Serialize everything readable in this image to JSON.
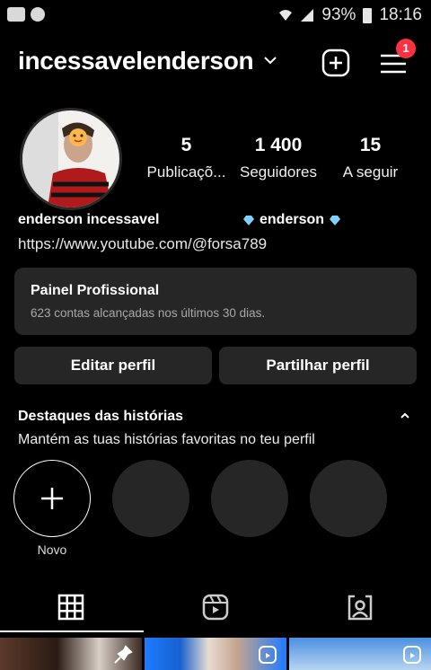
{
  "status_bar": {
    "battery": "93%",
    "time": "18:16"
  },
  "header": {
    "username": "incessavelenderson",
    "notification_count": "1"
  },
  "profile": {
    "stats": [
      {
        "value": "5",
        "label": "Publicaçõ..."
      },
      {
        "value": "1 400",
        "label": "Seguidores"
      },
      {
        "value": "15",
        "label": "A seguir"
      }
    ],
    "display_name": "enderson incessavel",
    "bio_name": "enderson",
    "link": "https://www.youtube.com/@forsa789"
  },
  "dashboard": {
    "title": "Painel Profissional",
    "subtitle": "623 contas alcançadas nos últimos 30 dias."
  },
  "buttons": {
    "edit": "Editar perfil",
    "share": "Partilhar perfil"
  },
  "highlights": {
    "title": "Destaques das histórias",
    "subtitle": "Mantém as tuas histórias favoritas no teu perfil",
    "new_label": "Novo"
  },
  "colors": {
    "background": "#000000",
    "surface": "#262626",
    "badge": "#ff3040"
  }
}
